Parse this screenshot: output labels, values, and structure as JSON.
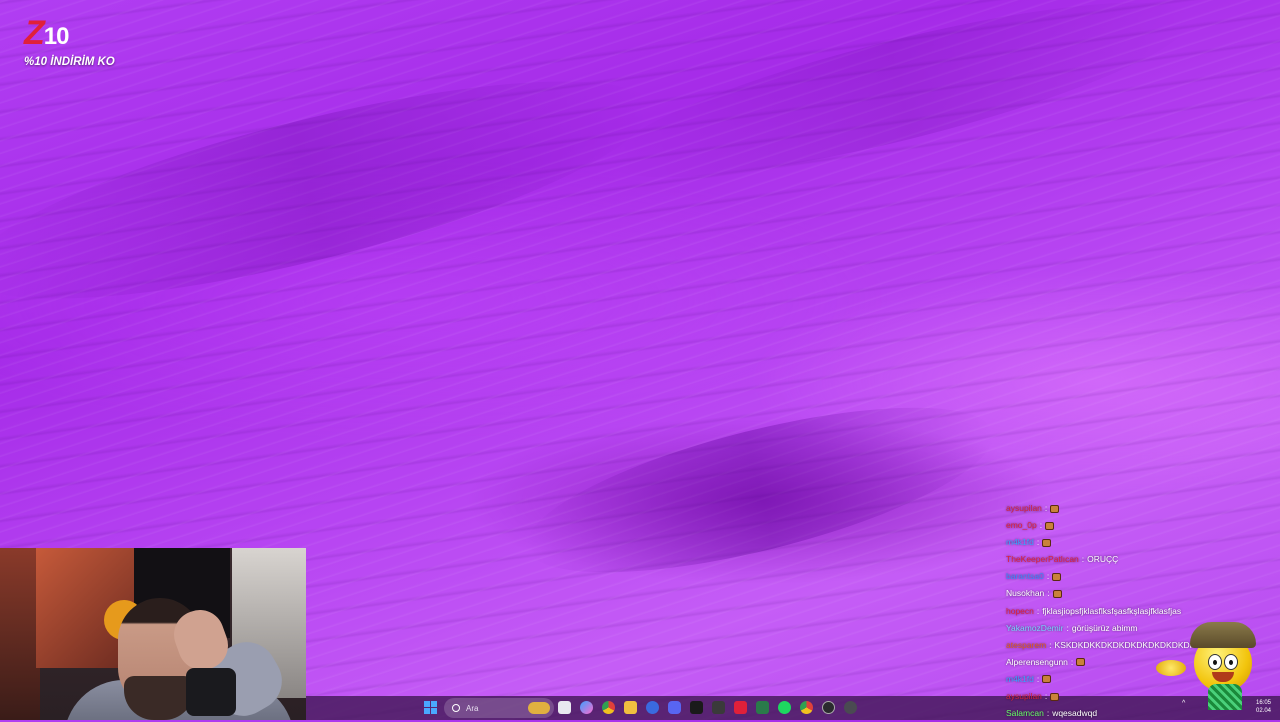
{
  "overlay": {
    "logo_brand_letter": "Z",
    "logo_brand_number": "10",
    "logo_tagline": "%10 İNDİRİM KO"
  },
  "taskbar": {
    "search_placeholder": "Ara",
    "clock_line1": "16:05",
    "clock_line2": "02.04"
  },
  "chat": {
    "messages": [
      {
        "user": "aysupilan",
        "user_color": "#d4243c",
        "text": "",
        "emote": true
      },
      {
        "user": "emo_0p",
        "user_color": "#e0203a",
        "text": "",
        "emote": true
      },
      {
        "user": "m4k1fd",
        "user_color": "#3aa0ff",
        "text": "",
        "emote": true
      },
      {
        "user": "TheKeeperPatlıcan",
        "user_color": "#e0203a",
        "text": "ORUÇÇ",
        "emote": false
      },
      {
        "user": "barantsa0",
        "user_color": "#3a8aff",
        "text": "",
        "emote": true
      },
      {
        "user": "Nusokhan",
        "user_color": "#ffffff",
        "text": "",
        "emote": true
      },
      {
        "user": "hopecn",
        "user_color": "#e0203a",
        "text": "fjklasjiopsfjklasflksfşasfkşlasjfklasfjas",
        "emote": false
      },
      {
        "user": "YakamozDemir",
        "user_color": "#7ad0ff",
        "text": "görüşürüz abimm",
        "emote": false
      },
      {
        "user": "atesparem",
        "user_color": "#e05a1a",
        "text": "KSKDKDKKDKDKDKDKDKDKDKDKDKDK",
        "emote": false
      },
      {
        "user": "Alperensengunn",
        "user_color": "#ffffff",
        "text": "",
        "emote": true
      },
      {
        "user": "m4k1fd",
        "user_color": "#3aa0ff",
        "text": "",
        "emote": true
      },
      {
        "user": "aysupilan",
        "user_color": "#d4243c",
        "text": "",
        "emote": true
      },
      {
        "user": "Salamcan",
        "user_color": "#6aff6a",
        "text": "wqesadwqd",
        "emote": false
      }
    ]
  }
}
